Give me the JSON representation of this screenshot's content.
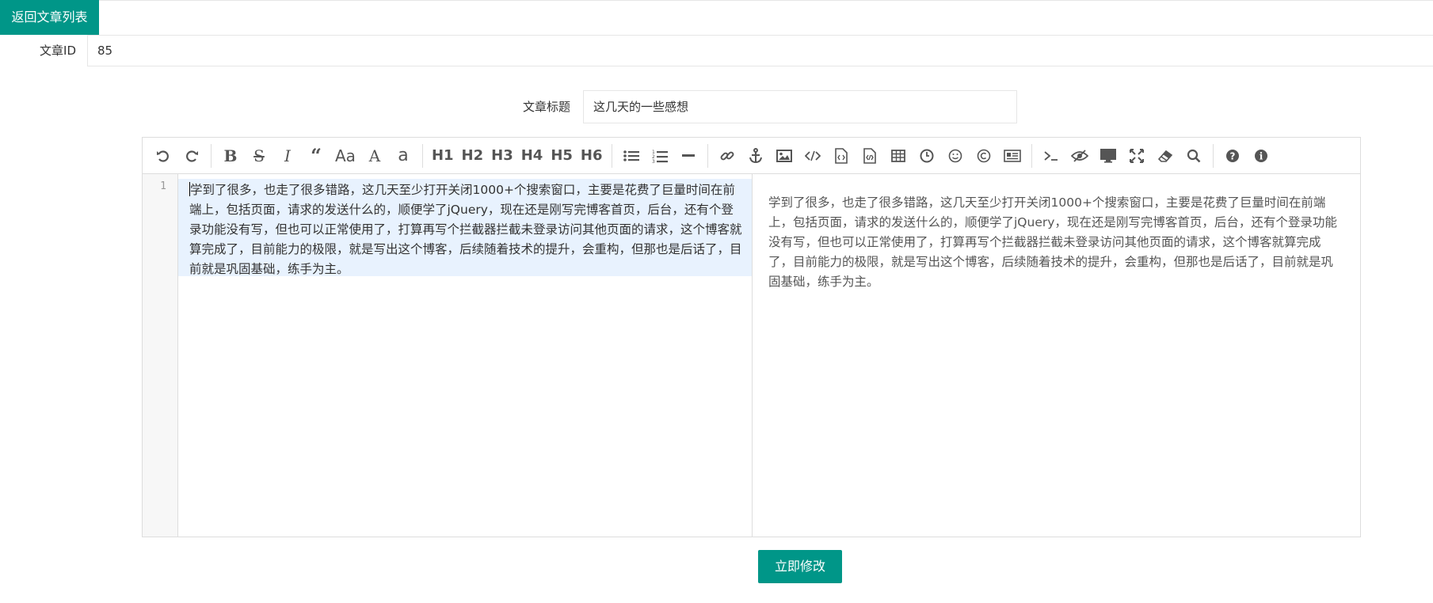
{
  "header": {
    "back_label": "返回文章列表"
  },
  "form": {
    "id_label": "文章ID",
    "id_value": "85",
    "title_label": "文章标题",
    "title_value": "这几天的一些感想",
    "submit_label": "立即修改"
  },
  "editor": {
    "toolbar": {
      "headings": [
        "H1",
        "H2",
        "H3",
        "H4",
        "H5",
        "H6"
      ],
      "icons": [
        "undo-icon",
        "redo-icon",
        "bold-icon",
        "strikethrough-icon",
        "italic-icon",
        "quote-icon",
        "uppercase-icon",
        "uppercase-first-icon",
        "lowercase-icon",
        "list-ul-icon",
        "list-ol-icon",
        "hr-icon",
        "link-icon",
        "anchor-icon",
        "image-icon",
        "code-icon",
        "preformatted-text-icon",
        "code-block-icon",
        "table-icon",
        "datetime-icon",
        "emoji-icon",
        "html-entities-icon",
        "pagebreak-icon",
        "goto-line-icon",
        "watch-icon",
        "preview-icon",
        "fullscreen-icon",
        "clear-icon",
        "search-icon",
        "help-icon",
        "info-icon"
      ]
    },
    "line_number": "1",
    "content": "学到了很多，也走了很多错路，这几天至少打开关闭1000+个搜索窗口，主要是花费了巨量时间在前端上，包括页面，请求的发送什么的，顺便学了jQuery，现在还是刚写完博客首页，后台，还有个登录功能没有写，但也可以正常使用了，打算再写个拦截器拦截未登录访问其他页面的请求，这个博客就算完成了，目前能力的极限，就是写出这个博客，后续随着技术的提升，会重构，但那也是后话了，目前就是巩固基础，练手为主。",
    "preview": "学到了很多，也走了很多错路，这几天至少打开关闭1000+个搜索窗口，主要是花费了巨量时间在前端上，包括页面，请求的发送什么的，顺便学了jQuery，现在还是刚写完博客首页，后台，还有个登录功能没有写，但也可以正常使用了，打算再写个拦截器拦截未登录访问其他页面的请求，这个博客就算完成了，目前能力的极限，就是写出这个博客，后续随着技术的提升，会重构，但那也是后话了，目前就是巩固基础，练手为主。"
  },
  "colors": {
    "accent": "#009688",
    "highlight": "#e8f2fe"
  }
}
